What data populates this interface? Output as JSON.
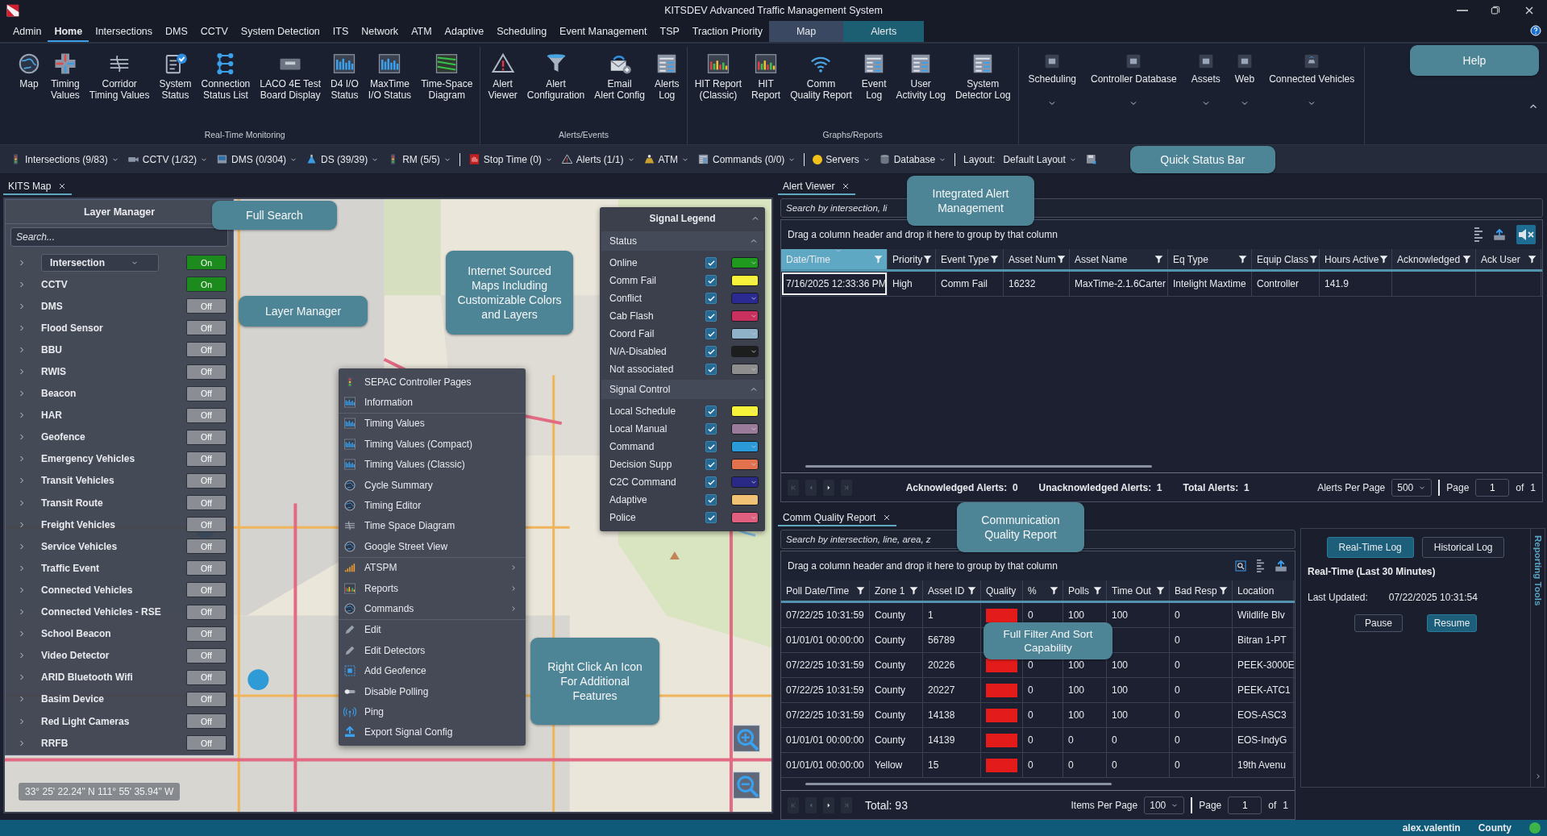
{
  "window": {
    "title": "KITSDEV Advanced Traffic Management System"
  },
  "menu": {
    "tabs": [
      {
        "label": "Admin",
        "selected": false
      },
      {
        "label": "Home",
        "selected": true
      },
      {
        "label": "Intersections",
        "selected": false
      },
      {
        "label": "DMS",
        "selected": false
      },
      {
        "label": "CCTV",
        "selected": false
      },
      {
        "label": "System Detection",
        "selected": false
      },
      {
        "label": "ITS",
        "selected": false
      },
      {
        "label": "Network",
        "selected": false
      },
      {
        "label": "ATM",
        "selected": false
      },
      {
        "label": "Adaptive",
        "selected": false
      },
      {
        "label": "Scheduling",
        "selected": false
      },
      {
        "label": "Event Management",
        "selected": false
      },
      {
        "label": "TSP",
        "selected": false
      },
      {
        "label": "Traction Priority",
        "selected": false
      },
      {
        "label": "Map",
        "selected": false,
        "color": "#3a4862"
      },
      {
        "label": "Alerts",
        "selected": false,
        "color": "#1d5f72"
      }
    ]
  },
  "ribbon": {
    "callout": "Help",
    "groups": [
      {
        "label": "Real-Time Monitoring",
        "buttons": [
          {
            "label": "Map",
            "kind": "large"
          },
          {
            "label": "Timing\nValues",
            "kind": "large"
          },
          {
            "label": "Corridor\nTiming Values",
            "kind": "large"
          },
          {
            "label": "System\nStatus",
            "kind": "large"
          },
          {
            "label": "Connection\nStatus List",
            "kind": "large"
          },
          {
            "label": "LACO 4E Test\nBoard Display",
            "kind": "large"
          },
          {
            "label": "D4 I/O\nStatus",
            "kind": "large"
          },
          {
            "label": "MaxTime\nI/O Status",
            "kind": "large"
          },
          {
            "label": "Time-Space\nDiagram",
            "kind": "large"
          }
        ]
      },
      {
        "label": "Alerts/Events",
        "buttons": [
          {
            "label": "Alert\nViewer",
            "kind": "large"
          },
          {
            "label": "Alert\nConfiguration",
            "kind": "large"
          },
          {
            "label": "Email\nAlert Config",
            "kind": "large"
          },
          {
            "label": "Alerts\nLog",
            "kind": "large"
          }
        ]
      },
      {
        "label": "Graphs/Reports",
        "buttons": [
          {
            "label": "HIT Report\n(Classic)",
            "kind": "large"
          },
          {
            "label": "HIT\nReport",
            "kind": "large"
          },
          {
            "label": "Comm\nQuality Report",
            "kind": "large"
          },
          {
            "label": "Event\nLog",
            "kind": "large"
          },
          {
            "label": "User\nActivity Log",
            "kind": "large"
          },
          {
            "label": "System\nDetector Log",
            "kind": "large"
          }
        ]
      },
      {
        "buttons": [
          {
            "label": "Scheduling",
            "kind": "dropdown"
          },
          {
            "label": "Controller Database",
            "kind": "dropdown"
          },
          {
            "label": "Assets",
            "kind": "dropdown"
          },
          {
            "label": "Web",
            "kind": "dropdown"
          },
          {
            "label": "Connected Vehicles",
            "kind": "dropdown"
          }
        ]
      }
    ]
  },
  "quick_status": {
    "callout": "Quick Status Bar",
    "items": [
      {
        "kind": "status",
        "label": "Intersections (9/83)"
      },
      {
        "kind": "status",
        "label": "CCTV (1/32)"
      },
      {
        "kind": "status",
        "label": "DMS (0/304)"
      },
      {
        "kind": "status",
        "label": "DS (39/39)"
      },
      {
        "kind": "status",
        "label": "RM (5/5)"
      },
      {
        "kind": "separator"
      },
      {
        "kind": "status",
        "label": "Stop Time (0)"
      },
      {
        "kind": "status",
        "label": "Alerts (1/1)"
      },
      {
        "kind": "status",
        "label": "ATM"
      },
      {
        "kind": "status",
        "label": "Commands (0/0)"
      },
      {
        "kind": "separator"
      },
      {
        "kind": "status",
        "label": "Servers",
        "color": "#f2c21b"
      },
      {
        "kind": "status",
        "label": "Database"
      },
      {
        "kind": "separator"
      },
      {
        "kind": "layout",
        "label": "Layout:",
        "value": "Default Layout"
      },
      {
        "kind": "save"
      }
    ]
  },
  "map_panel": {
    "tab": "KITS Map",
    "callouts": [
      "Full Search",
      "Layer Manager",
      "Internet Sourced Maps Including Customizable Colors and Layers",
      "Right Click An Icon For Additional Features"
    ],
    "layer_manager": {
      "title": "Layer Manager",
      "search": {
        "placeholder": "Search..."
      },
      "items": [
        {
          "name": "Intersection",
          "kind": "select",
          "on": true,
          "toggle": "On"
        },
        {
          "name": "CCTV",
          "kind": "plain",
          "on": true,
          "toggle": "On"
        },
        {
          "name": "DMS",
          "kind": "plain",
          "on": false,
          "toggle": "Off"
        },
        {
          "name": "Flood Sensor",
          "kind": "plain",
          "on": false,
          "toggle": "Off"
        },
        {
          "name": "BBU",
          "kind": "plain",
          "on": false,
          "toggle": "Off"
        },
        {
          "name": "RWIS",
          "kind": "plain",
          "on": false,
          "toggle": "Off"
        },
        {
          "name": "Beacon",
          "kind": "plain",
          "on": false,
          "toggle": "Off"
        },
        {
          "name": "HAR",
          "kind": "plain",
          "on": false,
          "toggle": "Off"
        },
        {
          "name": "Geofence",
          "kind": "plain",
          "on": false,
          "toggle": "Off"
        },
        {
          "name": "Emergency Vehicles",
          "kind": "plain",
          "on": false,
          "toggle": "Off"
        },
        {
          "name": "Transit Vehicles",
          "kind": "plain",
          "on": false,
          "toggle": "Off"
        },
        {
          "name": "Transit Route",
          "kind": "plain",
          "on": false,
          "toggle": "Off"
        },
        {
          "name": "Freight Vehicles",
          "kind": "plain",
          "on": false,
          "toggle": "Off"
        },
        {
          "name": "Service Vehicles",
          "kind": "plain",
          "on": false,
          "toggle": "Off"
        },
        {
          "name": "Traffic Event",
          "kind": "plain",
          "on": false,
          "toggle": "Off"
        },
        {
          "name": "Connected Vehicles",
          "kind": "plain",
          "on": false,
          "toggle": "Off"
        },
        {
          "name": "Connected Vehicles - RSE",
          "kind": "plain",
          "on": false,
          "toggle": "Off"
        },
        {
          "name": "School Beacon",
          "kind": "plain",
          "on": false,
          "toggle": "Off"
        },
        {
          "name": "Video Detector",
          "kind": "plain",
          "on": false,
          "toggle": "Off"
        },
        {
          "name": "ARID Bluetooth Wifi",
          "kind": "plain",
          "on": false,
          "toggle": "Off"
        },
        {
          "name": "Basim Device",
          "kind": "plain",
          "on": false,
          "toggle": "Off"
        },
        {
          "name": "Red Light Cameras",
          "kind": "plain",
          "on": false,
          "toggle": "Off"
        },
        {
          "name": "RRFB",
          "kind": "plain",
          "on": false,
          "toggle": "Off"
        }
      ]
    },
    "legend": {
      "title": "Signal Legend",
      "sections": [
        {
          "title": "Status",
          "items": [
            {
              "label": "Online",
              "checked": true,
              "color": "#1f9a1f"
            },
            {
              "label": "Comm Fail",
              "checked": true,
              "color": "#f6f33a"
            },
            {
              "label": "Conflict",
              "checked": true,
              "color": "#2a2a92"
            },
            {
              "label": "Cab Flash",
              "checked": true,
              "color": "#c8305e"
            },
            {
              "label": "Coord Fail",
              "checked": true,
              "color": "#8fb2c8"
            },
            {
              "label": "N/A-Disabled",
              "checked": true,
              "color": "#1c1e1e"
            },
            {
              "label": "Not associated",
              "checked": true,
              "color": "#8e8e8e"
            }
          ]
        },
        {
          "title": "Signal Control",
          "items": [
            {
              "label": "Local Schedule",
              "checked": true,
              "color": "#f6f33a"
            },
            {
              "label": "Local Manual",
              "checked": true,
              "color": "#9a7c9a"
            },
            {
              "label": "Command",
              "checked": true,
              "color": "#2a9ad8"
            },
            {
              "label": "Decision Supp",
              "checked": true,
              "color": "#e2714e"
            },
            {
              "label": "C2C Command",
              "checked": true,
              "color": "#2a2a86"
            },
            {
              "label": "Adaptive",
              "checked": true,
              "color": "#f2c274"
            },
            {
              "label": "Police",
              "checked": true,
              "color": "#e05e7e"
            }
          ]
        }
      ]
    },
    "context_menu": {
      "groups": [
        [
          {
            "label": "SEPAC Controller Pages",
            "submenu": false
          },
          {
            "label": "Information",
            "submenu": false
          }
        ],
        [
          {
            "label": "Timing Values",
            "submenu": false
          },
          {
            "label": "Timing Values (Compact)",
            "submenu": false
          },
          {
            "label": "Timing Values (Classic)",
            "submenu": false
          },
          {
            "label": "Cycle Summary",
            "submenu": false
          },
          {
            "label": "Timing Editor",
            "submenu": false
          },
          {
            "label": "Time Space Diagram",
            "submenu": false
          },
          {
            "label": "Google Street View",
            "submenu": false
          }
        ],
        [
          {
            "label": "ATSPM",
            "submenu": true
          },
          {
            "label": "Reports",
            "submenu": true
          },
          {
            "label": "Commands",
            "submenu": true
          }
        ],
        [
          {
            "label": "Edit",
            "submenu": false
          },
          {
            "label": "Edit Detectors",
            "submenu": false
          },
          {
            "label": "Add Geofence",
            "submenu": false
          },
          {
            "label": "Disable Polling",
            "submenu": false
          },
          {
            "label": "Ping",
            "submenu": false
          },
          {
            "label": "Export Signal Config",
            "submenu": false
          }
        ]
      ]
    },
    "coordinates": "33° 25' 22.24\" N 111° 55' 35.94\" W"
  },
  "alert_viewer": {
    "tab": "Alert Viewer",
    "callout": "Integrated Alert Management",
    "search": {
      "placeholder": "Search by intersection, li"
    },
    "group_hint": "Drag a column header and drop it here to group by that column",
    "columns": [
      {
        "label": "Date/Time",
        "selected": true
      },
      {
        "label": "Priority",
        "selected": false
      },
      {
        "label": "Event Type",
        "selected": false
      },
      {
        "label": "Asset Num",
        "selected": false
      },
      {
        "label": "Asset Name",
        "selected": false
      },
      {
        "label": "Eq Type",
        "selected": false
      },
      {
        "label": "Equip Class",
        "selected": false
      },
      {
        "label": "Hours Active",
        "selected": false
      },
      {
        "label": "Acknowledged",
        "selected": false
      },
      {
        "label": "Ack User",
        "selected": false
      }
    ],
    "rows": [
      {
        "cells": [
          "7/16/2025 12:33:36 PM",
          "High",
          "Comm Fail",
          "16232",
          "MaxTime-2.1.6Carter",
          "Intelight Maxtime",
          "Controller",
          "141.9"
        ]
      }
    ],
    "footer": {
      "stats": [
        {
          "label": "Acknowledged Alerts:",
          "value": "0"
        },
        {
          "label": "Unacknowledged Alerts:",
          "value": "1"
        },
        {
          "label": "Total Alerts:",
          "value": "1"
        }
      ],
      "per_page_label": "Alerts Per Page",
      "per_page": "500",
      "page_label": "Page",
      "page": "1",
      "of_label": "of",
      "pages": "1"
    }
  },
  "comm_quality": {
    "tab": "Comm Quality Report",
    "callouts": [
      "Communication Quality Report",
      "Full Filter And Sort Capability"
    ],
    "search": {
      "placeholder": "Search by intersection, line, area, z"
    },
    "group_hint": "Drag a column header and drop it here to group by that column",
    "columns": [
      {
        "label": "Poll Date/Time",
        "filter": true
      },
      {
        "label": "Zone 1",
        "filter": true
      },
      {
        "label": "Asset ID",
        "filter": true
      },
      {
        "label": "Quality",
        "filter": false
      },
      {
        "label": "%",
        "filter": true
      },
      {
        "label": "Polls",
        "filter": true
      },
      {
        "label": "Time Out",
        "filter": true
      },
      {
        "label": "Bad Resp",
        "filter": true
      },
      {
        "label": "Location",
        "filter": false
      }
    ],
    "rows": [
      {
        "poll": "07/22/25 10:31:59",
        "zone": "County",
        "asset_id": "1",
        "quality": {
          "color": "#e31b1b"
        },
        "percent": "0",
        "polls": "100",
        "time_out": "100",
        "bad_resp": "0",
        "location": "Wildlife Blv"
      },
      {
        "poll": "01/01/01 00:00:00",
        "zone": "County",
        "asset_id": "56789",
        "bad_resp": "0",
        "location": "Bitran 1-PT"
      },
      {
        "poll": "07/22/25 10:31:59",
        "zone": "County",
        "asset_id": "20226",
        "quality": {
          "color": "#e31b1b"
        },
        "percent": "0",
        "polls": "100",
        "time_out": "100",
        "bad_resp": "0",
        "location": "PEEK-3000E"
      },
      {
        "poll": "07/22/25 10:31:59",
        "zone": "County",
        "asset_id": "20227",
        "quality": {
          "color": "#e31b1b"
        },
        "percent": "0",
        "polls": "100",
        "time_out": "100",
        "bad_resp": "0",
        "location": "PEEK-ATC1"
      },
      {
        "poll": "07/22/25 10:31:59",
        "zone": "County",
        "asset_id": "14138",
        "quality": {
          "color": "#e31b1b"
        },
        "percent": "0",
        "polls": "100",
        "time_out": "100",
        "bad_resp": "0",
        "location": "EOS-ASC3"
      },
      {
        "poll": "01/01/01 00:00:00",
        "zone": "County",
        "asset_id": "14139",
        "quality": {
          "color": "#e31b1b"
        },
        "percent": "0",
        "polls": "0",
        "time_out": "0",
        "bad_resp": "0",
        "location": "EOS-IndyG"
      },
      {
        "poll": "01/01/01 00:00:00",
        "zone": "Yellow",
        "asset_id": "15",
        "quality": {
          "color": "#e31b1b"
        },
        "percent": "0",
        "polls": "0",
        "time_out": "0",
        "bad_resp": "0",
        "location": "19th Avenu"
      }
    ],
    "footer": {
      "total": "Total: 93",
      "per_page_label": "Items Per Page",
      "per_page": "100",
      "page_label": "Page",
      "page": "1",
      "of_label": "of",
      "pages": "1"
    },
    "log_panel": {
      "modes": [
        {
          "label": "Real-Time Log",
          "selected": true
        },
        {
          "label": "Historical Log",
          "selected": false
        }
      ],
      "heading": "Real-Time (Last 30 Minutes)",
      "updated_label": "Last Updated:",
      "updated": "07/22/2025 10:31:54",
      "actions": [
        {
          "label": "Pause",
          "selected": false
        },
        {
          "label": "Resume",
          "selected": true
        }
      ],
      "side_tab": "Reporting Tools"
    }
  },
  "status_bar": {
    "user": "alex.valentin",
    "zone": "County",
    "online": true
  }
}
